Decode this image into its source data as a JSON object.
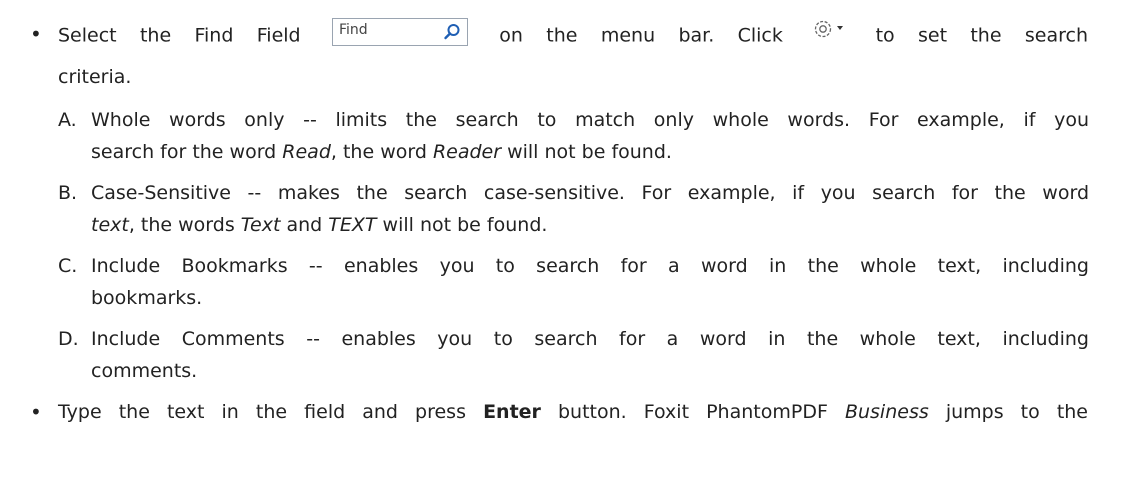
{
  "b1": {
    "p1": "Select the Find Field",
    "find_placeholder": "Find",
    "p2": "on the menu bar. Click",
    "p3": "to set the search",
    "p4": "criteria."
  },
  "items": [
    {
      "label": "A.",
      "l1": "Whole words only -- limits the search to match only whole words. For example, if you",
      "l2a": "search for the word ",
      "l2b": "Read",
      "l2c": ", the word ",
      "l2d": "Reader",
      "l2e": " will not be found."
    },
    {
      "label": "B.",
      "l1": "Case-Sensitive -- makes the search case-sensitive. For example, if you search for the word",
      "l2a": "text",
      "l2b": ", the words ",
      "l2c": "Text",
      "l2d": " and ",
      "l2e": "TEXT",
      "l2f": " will not be found."
    },
    {
      "label": "C.",
      "l1": "Include Bookmarks -- enables you to search for a word in the whole text, including",
      "l2": "bookmarks."
    },
    {
      "label": "D.",
      "l1": "Include Comments -- enables you to search for a word in the whole text, including",
      "l2": "comments."
    }
  ],
  "b2": {
    "a": "Type the text in the field and press ",
    "b": "Enter",
    "c": " button. Foxit PhantomPDF ",
    "d": "Business",
    "e": " jumps to the"
  },
  "icons": {
    "search": "search-icon",
    "gear": "gear-dropdown-icon"
  },
  "colors": {
    "text": "#222222",
    "field_border": "#9aa4b1",
    "icon_blue": "#1f5fb4"
  }
}
